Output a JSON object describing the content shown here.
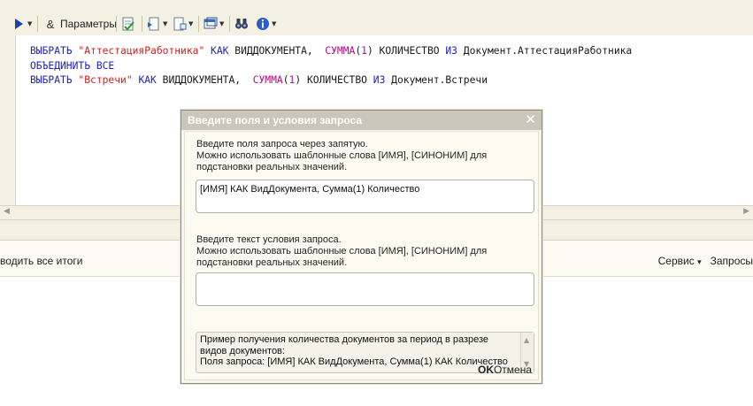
{
  "toolbar": {
    "params_label": "Параметры",
    "icons": [
      "play-icon",
      "ampersand-icon",
      "check-document-icon",
      "insert-document-icon",
      "document-add-icon",
      "window-icon",
      "binoculars-icon",
      "info-icon"
    ]
  },
  "editor": {
    "lines": [
      [
        {
          "t": "ВЫБРАТЬ ",
          "c": "kw"
        },
        {
          "t": "\"АттестацияРаботника\"",
          "c": "str"
        },
        {
          "t": " КАК ",
          "c": "kw"
        },
        {
          "t": "ВИДДОКУМЕНТА,  ",
          "c": "plain"
        },
        {
          "t": "СУММА",
          "c": "fn"
        },
        {
          "t": "(",
          "c": "plain"
        },
        {
          "t": "1",
          "c": "num"
        },
        {
          "t": ")",
          "c": "plain"
        },
        {
          "t": " КОЛИЧЕСТВО ",
          "c": "plain"
        },
        {
          "t": "ИЗ ",
          "c": "kw"
        },
        {
          "t": "Документ.АттестацияРаботника",
          "c": "plain"
        }
      ],
      [
        {
          "t": "ОБЪЕДИНИТЬ ВСЕ",
          "c": "kw"
        }
      ],
      [
        {
          "t": "ВЫБРАТЬ ",
          "c": "kw"
        },
        {
          "t": "\"Встречи\"",
          "c": "str"
        },
        {
          "t": " КАК ",
          "c": "kw"
        },
        {
          "t": "ВИДДОКУМЕНТА,  ",
          "c": "plain"
        },
        {
          "t": "СУММА",
          "c": "fn"
        },
        {
          "t": "(",
          "c": "plain"
        },
        {
          "t": "1",
          "c": "num"
        },
        {
          "t": ")",
          "c": "plain"
        },
        {
          "t": " КОЛИЧЕСТВО ",
          "c": "plain"
        },
        {
          "t": "ИЗ ",
          "c": "kw"
        },
        {
          "t": "Документ.Встречи",
          "c": "plain"
        }
      ]
    ]
  },
  "bottom": {
    "left_label": "водить все итоги",
    "service_label": "Сервис",
    "service_arrow": "▾",
    "queries_label": "Запросы"
  },
  "dialog": {
    "title": "Введите поля и условия запроса",
    "close_glyph": "✕",
    "fields_prompt": [
      "Введите поля запроса через запятую.",
      "Можно использовать шаблонные слова [ИМЯ], [СИНОНИМ] для",
      "подстановки реальных значений."
    ],
    "fields_value": "[ИМЯ] КАК ВидДокумента,  Сумма(1) Количество",
    "condition_prompt": [
      "Введите текст условия запроса.",
      "Можно использовать шаблонные слова [ИМЯ], [СИНОНИМ] для",
      "подстановки реальных значений."
    ],
    "condition_value": "",
    "example_lines": [
      "Пример получения количества документов за период в разрезе",
      "видов документов:",
      "Поля запроса: [ИМЯ] КАК ВидДокумента, Сумма(1) КАК Количество"
    ],
    "ok_label": "OK",
    "cancel_label": "Отмена"
  },
  "colors": {
    "keyword": "#2020c8",
    "string": "#d02020",
    "function": "#c00080",
    "toolbar_bg": "#f3f1e4",
    "dialog_title_bg": "#c9c6bc"
  }
}
